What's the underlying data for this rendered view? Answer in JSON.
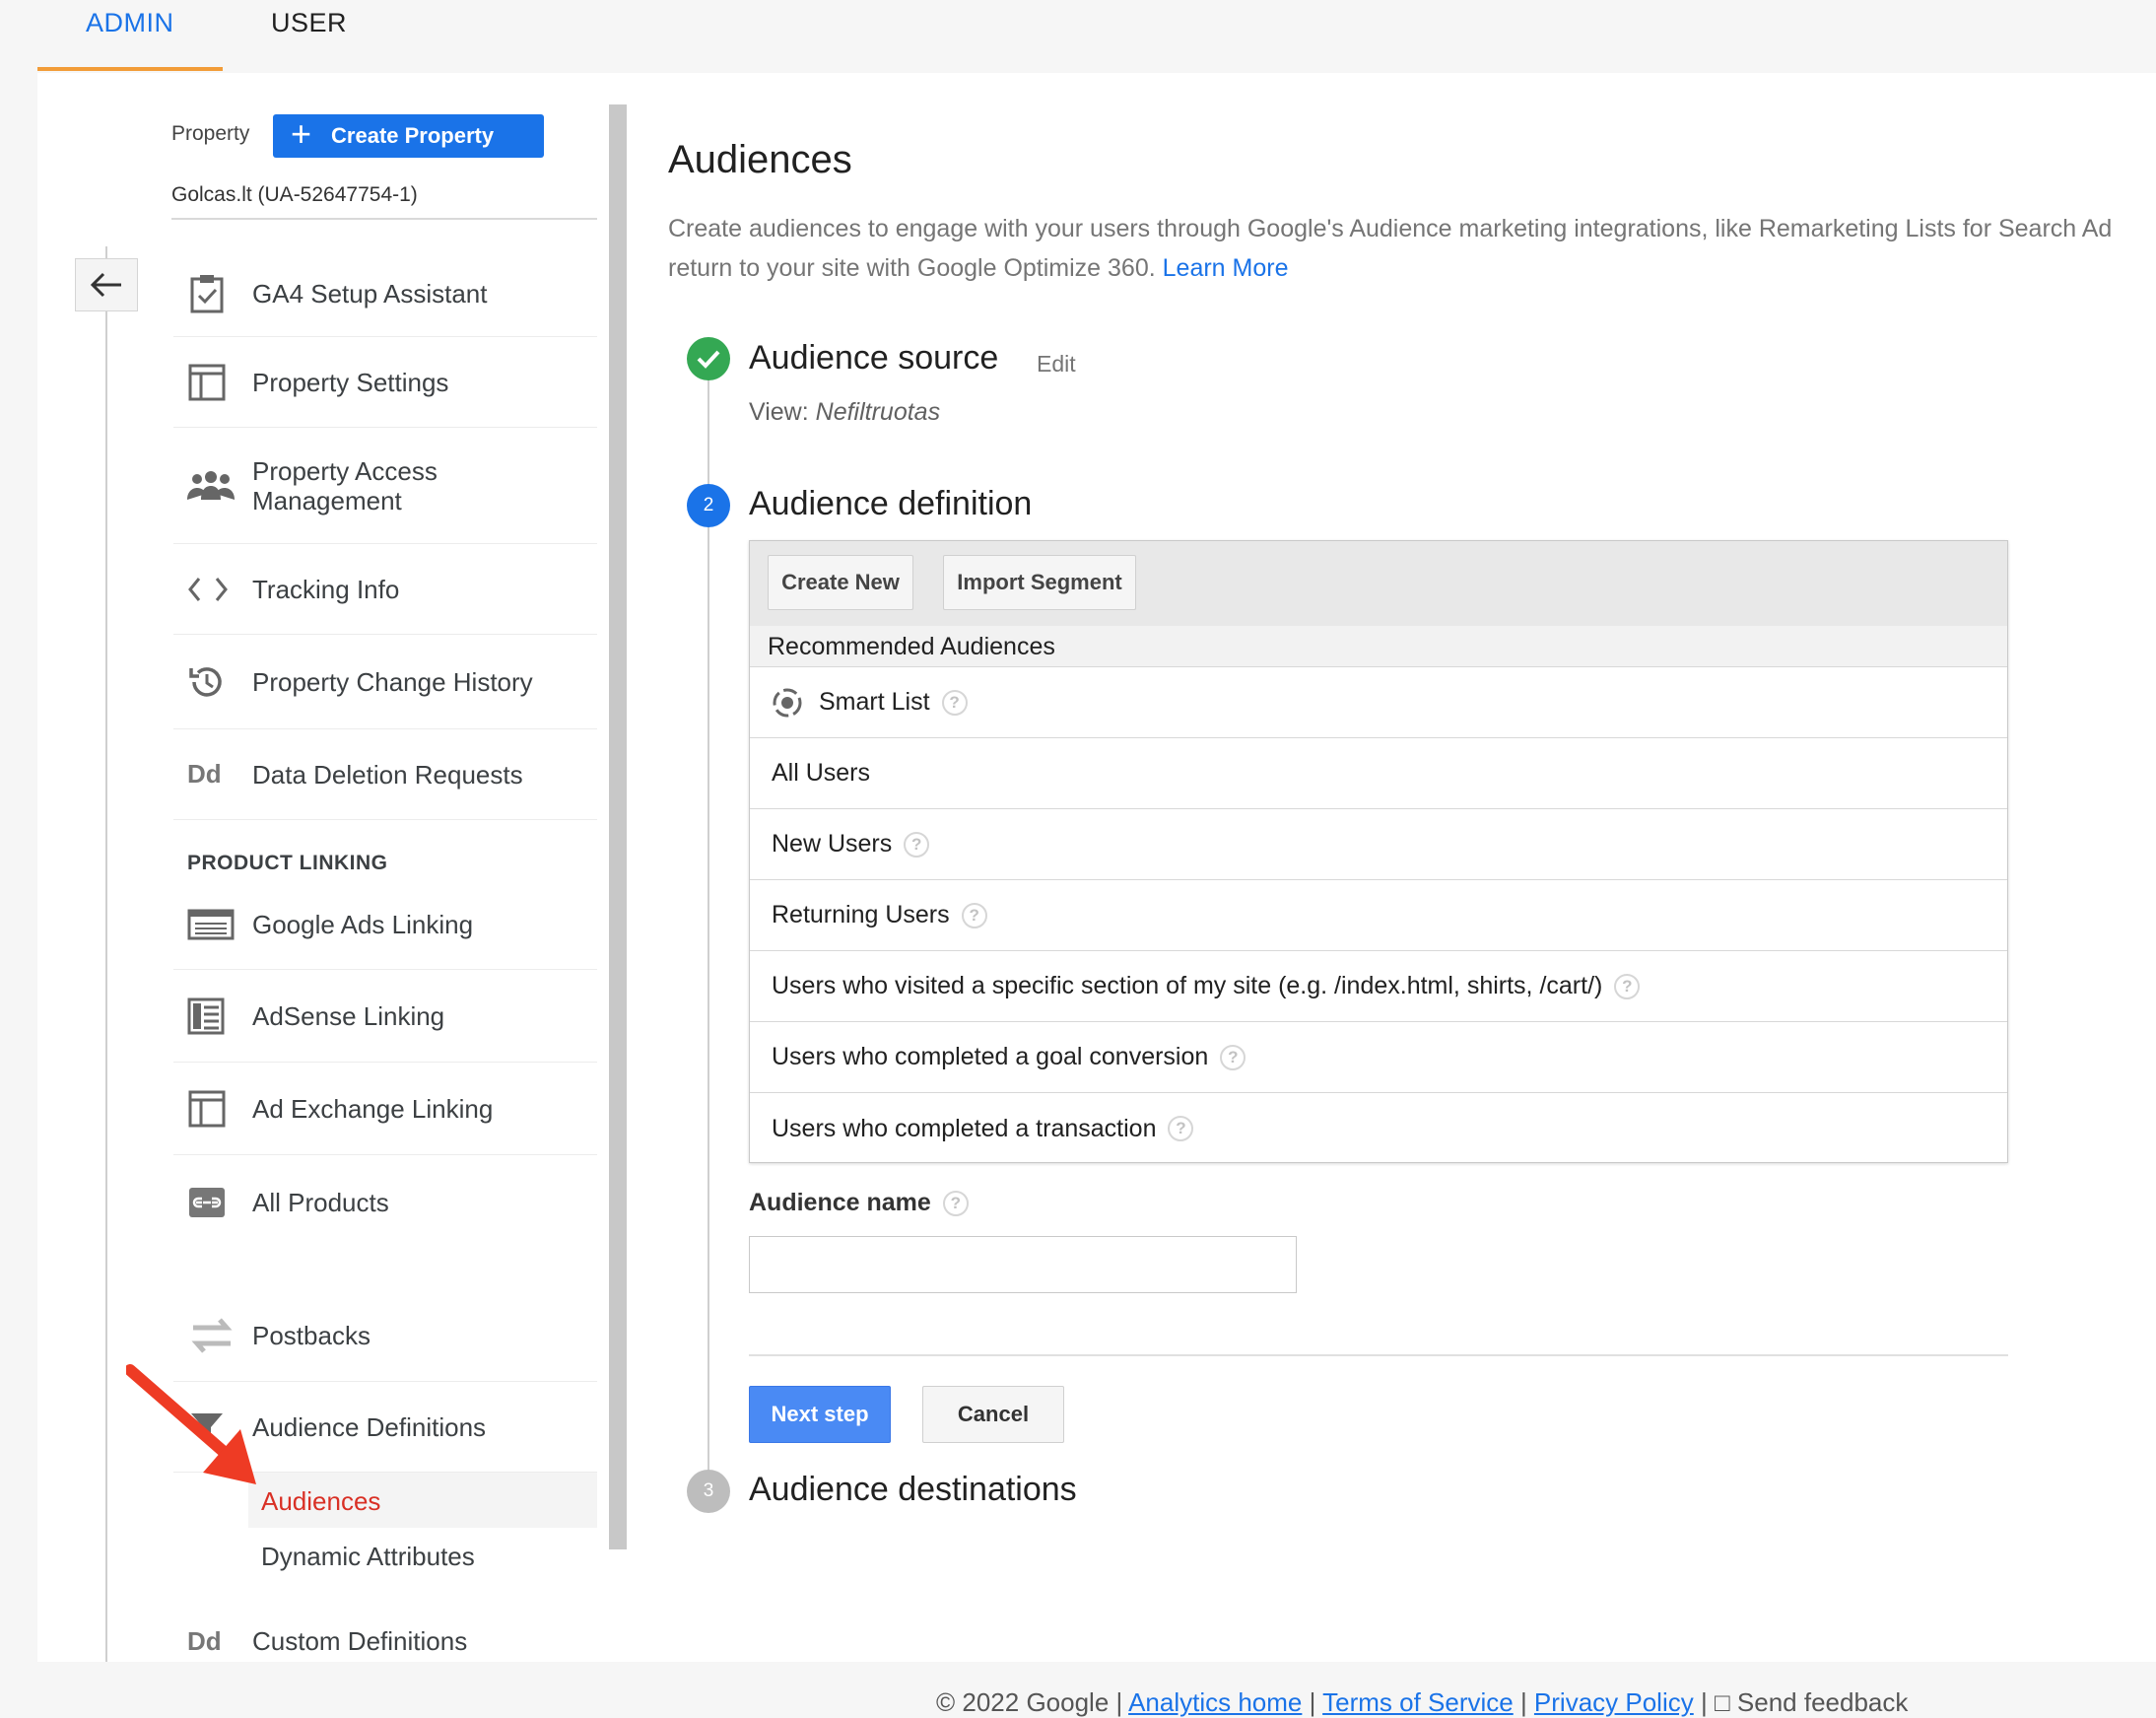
{
  "tabs": {
    "admin": "ADMIN",
    "user": "USER"
  },
  "sidebar": {
    "property_label": "Property",
    "create_property": "Create Property",
    "account_name": "Golcas.lt (UA-52647754-1)",
    "items": [
      {
        "label": "GA4 Setup Assistant",
        "icon": "clipboard-check-icon"
      },
      {
        "label": "Property Settings",
        "icon": "layout-icon"
      },
      {
        "label": "Property Access Management",
        "icon": "people-icon"
      },
      {
        "label": "Tracking Info",
        "icon": "code-icon"
      },
      {
        "label": "Property Change History",
        "icon": "history-icon"
      },
      {
        "label": "Data Deletion Requests",
        "icon": "dd-icon"
      }
    ],
    "section_product_linking": "PRODUCT LINKING",
    "linking_items": [
      {
        "label": "Google Ads Linking",
        "icon": "ads-icon"
      },
      {
        "label": "AdSense Linking",
        "icon": "adsense-icon"
      },
      {
        "label": "Ad Exchange Linking",
        "icon": "layout-icon"
      },
      {
        "label": "All Products",
        "icon": "link-icon"
      }
    ],
    "postbacks": "Postbacks",
    "audience_definitions": "Audience Definitions",
    "sub_items": [
      "Audiences",
      "Dynamic Attributes"
    ],
    "custom_definitions": "Custom Definitions"
  },
  "main": {
    "title": "Audiences",
    "description_1": "Create audiences to engage with your users through Google's Audience marketing integrations, like Remarketing Lists for Search Ad",
    "description_2": "return to your site with Google Optimize 360.",
    "learn_more": "Learn More",
    "step1": {
      "title": "Audience source",
      "edit": "Edit",
      "view_label": "View:",
      "view_name": "Nefiltruotas"
    },
    "step2": {
      "number": "2",
      "title": "Audience definition",
      "create_new": "Create New",
      "import_segment": "Import Segment",
      "recommended_header": "Recommended Audiences",
      "audiences": [
        "Smart List",
        "All Users",
        "New Users",
        "Returning Users",
        "Users who visited a specific section of my site (e.g. /index.html, shirts, /cart/)",
        "Users who completed a goal conversion",
        "Users who completed a transaction"
      ],
      "audience_name_label": "Audience name",
      "audience_name_value": "",
      "next_step": "Next step",
      "cancel": "Cancel"
    },
    "step3": {
      "number": "3",
      "title": "Audience destinations"
    }
  },
  "footer": {
    "copyright": "© 2022 Google |",
    "links": [
      "Analytics home",
      "Terms of Service",
      "Privacy Policy"
    ],
    "feedback": "Send feedback"
  },
  "colors": {
    "accent": "#1a73e8",
    "tab_underline": "#f29c38",
    "active_red": "#d93025",
    "success": "#34a853"
  }
}
